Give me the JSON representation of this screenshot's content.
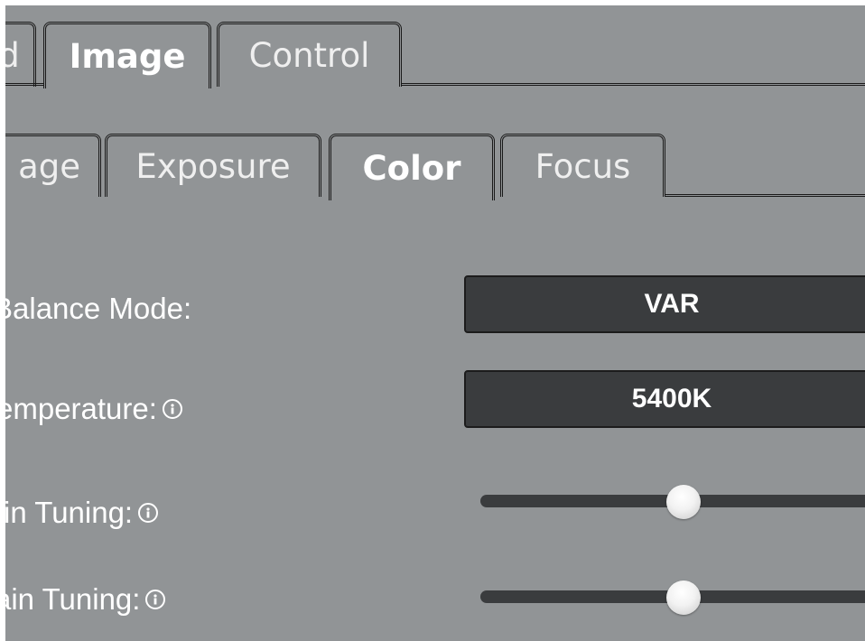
{
  "tabs_primary": [
    {
      "label": "d",
      "active": false
    },
    {
      "label": "Image",
      "active": true
    },
    {
      "label": "Control",
      "active": false
    }
  ],
  "tabs_secondary": [
    {
      "label": "age",
      "active": false
    },
    {
      "label": "Exposure",
      "active": false
    },
    {
      "label": "Color",
      "active": true
    },
    {
      "label": "Focus",
      "active": false
    }
  ],
  "settings": {
    "balance_mode": {
      "label": "Balance Mode:",
      "value": "VAR"
    },
    "temperature": {
      "label": "emperature:",
      "value": "5400K",
      "icon": "info-icon"
    },
    "tuning_1": {
      "label": "in Tuning:",
      "icon": "info-icon",
      "level": 0.5
    },
    "tuning_2": {
      "label": "ain Tuning:",
      "icon": "info-icon",
      "level": 0.5
    }
  },
  "colors": {
    "panel_bg": "#919496",
    "control_bg": "#3a3c3e",
    "text": "#ffffff"
  }
}
